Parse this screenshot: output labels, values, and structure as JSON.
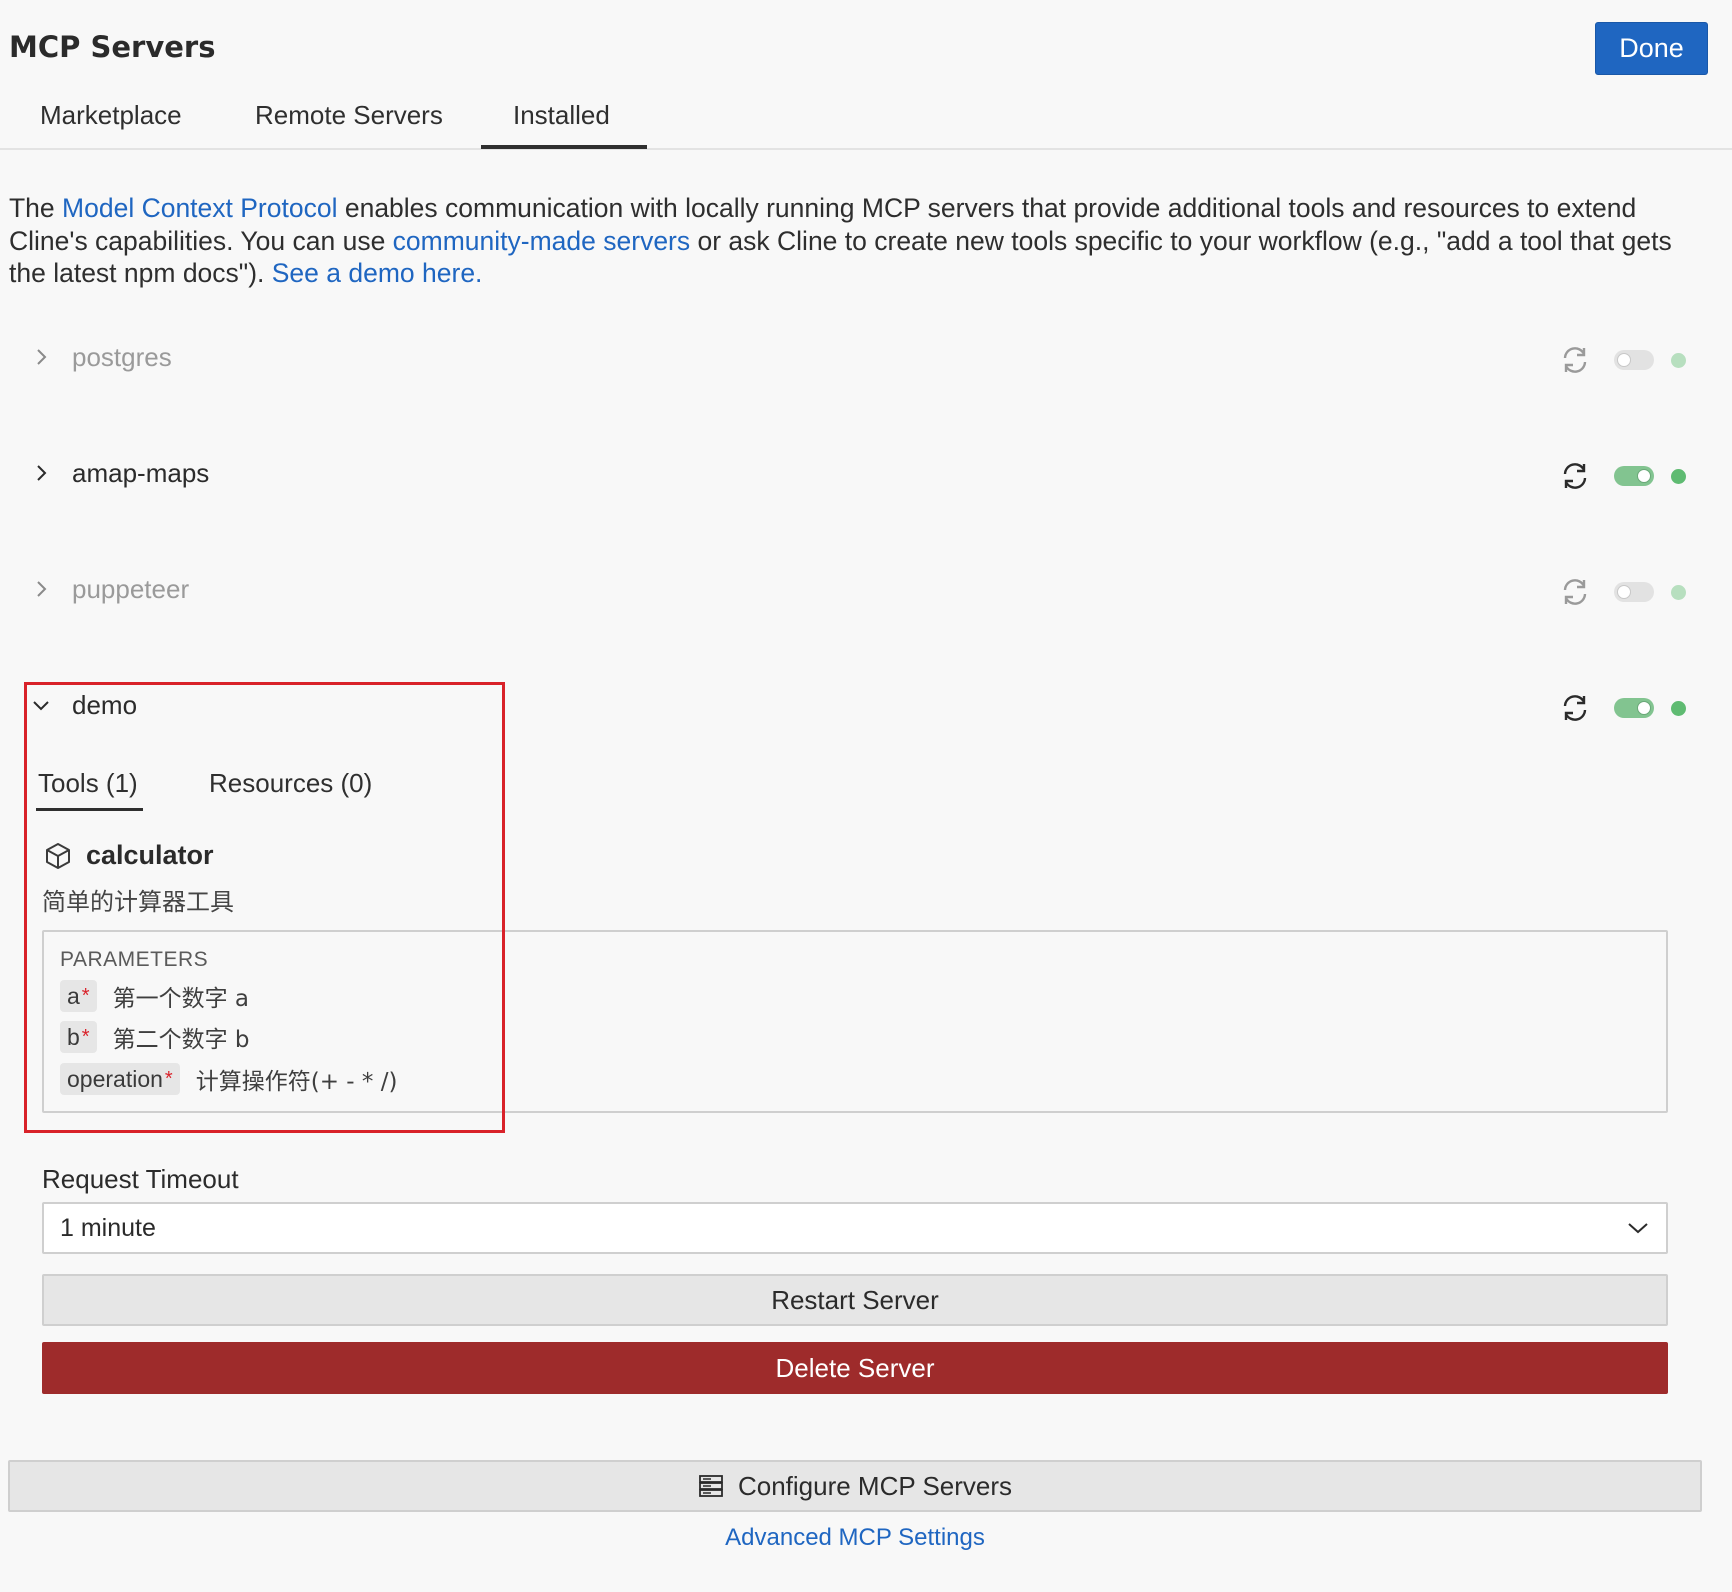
{
  "header": {
    "title": "MCP Servers",
    "done_label": "Done"
  },
  "tabs": [
    {
      "label": "Marketplace"
    },
    {
      "label": "Remote Servers"
    },
    {
      "label": "Installed",
      "active": true
    }
  ],
  "intro": {
    "part1": "The ",
    "link1": "Model Context Protocol",
    "part2": " enables communication with locally running MCP servers that provide additional tools and resources to extend Cline's capabilities. You can use ",
    "link2": "community-made servers",
    "part3": " or ask Cline to create new tools specific to your workflow (e.g., \"add a tool that gets the latest npm docs\"). ",
    "link3": "See a demo here."
  },
  "servers": [
    {
      "name": "postgres",
      "enabled": false,
      "expanded": false
    },
    {
      "name": "amap-maps",
      "enabled": true,
      "expanded": false
    },
    {
      "name": "puppeteer",
      "enabled": false,
      "expanded": false
    },
    {
      "name": "demo",
      "enabled": true,
      "expanded": true
    }
  ],
  "demo": {
    "subtabs": [
      {
        "label": "Tools (1)",
        "active": true
      },
      {
        "label": "Resources (0)"
      }
    ],
    "tool": {
      "icon": "cube-icon",
      "name": "calculator",
      "description": "简单的计算器工具",
      "params_title": "PARAMETERS",
      "params": [
        {
          "name": "a",
          "required_mark": "*",
          "description": "第一个数字 a"
        },
        {
          "name": "b",
          "required_mark": "*",
          "description": "第二个数字 b"
        },
        {
          "name": "operation",
          "required_mark": "*",
          "description": "计算操作符(+ - * /)"
        }
      ]
    },
    "timeout_label": "Request Timeout",
    "timeout_value": "1 minute",
    "restart_label": "Restart Server",
    "delete_label": "Delete Server"
  },
  "footer": {
    "configure_label": "Configure MCP Servers",
    "advanced_link": "Advanced MCP Settings"
  },
  "colors": {
    "accent": "#1f66c1",
    "danger": "#9e2b2b",
    "highlight": "#d9222a",
    "status_green": "#5fbb72"
  }
}
